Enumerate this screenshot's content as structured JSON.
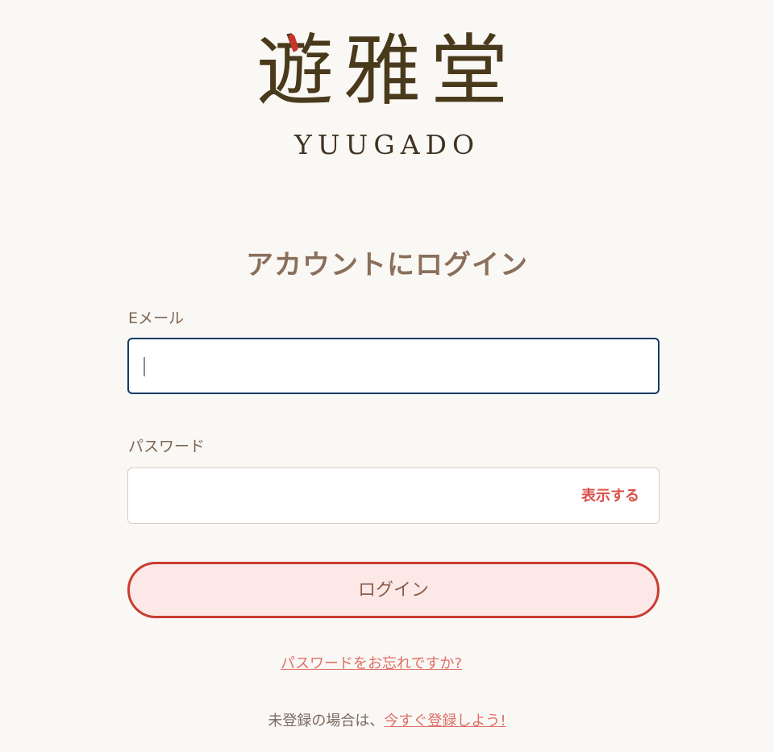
{
  "brand": {
    "logo_kanji": "遊雅堂",
    "logo_roman": "YUUGADO"
  },
  "login": {
    "title": "アカウントにログイン",
    "email": {
      "label": "Eメール",
      "value": "",
      "placeholder": ""
    },
    "password": {
      "label": "パスワード",
      "value": "",
      "placeholder": "",
      "toggle_label": "表示する"
    },
    "submit_label": "ログイン",
    "forgot_password_link": "パスワードをお忘れですか?",
    "register_prompt": "未登録の場合は、",
    "register_link": "今すぐ登録しよう!"
  },
  "colors": {
    "page_background": "#faf8f5",
    "title_text": "#8a6f5a",
    "accent_red": "#c93d31",
    "link": "#df6f67",
    "focus_border": "#123b64"
  },
  "icons": {
    "logo_accent": "red-brush-dot-icon"
  }
}
